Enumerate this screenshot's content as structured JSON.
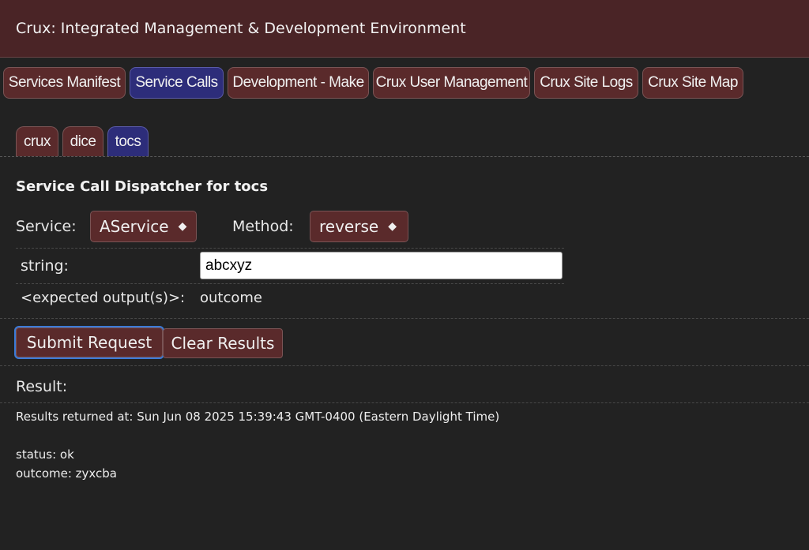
{
  "header": {
    "title": "Crux: Integrated Management & Development Environment"
  },
  "main_tabs": [
    {
      "label": "Services Manifest",
      "active": false
    },
    {
      "label": "Service Calls",
      "active": true
    },
    {
      "label": "Development - Make",
      "active": false
    },
    {
      "label": "Crux User Management",
      "active": false
    },
    {
      "label": "Crux Site Logs",
      "active": false
    },
    {
      "label": "Crux Site Map",
      "active": false
    }
  ],
  "sub_tabs": [
    {
      "label": "crux",
      "active": false
    },
    {
      "label": "dice",
      "active": false
    },
    {
      "label": "tocs",
      "active": true
    }
  ],
  "dispatcher": {
    "heading": "Service Call Dispatcher for tocs",
    "service_label": "Service:",
    "service_value": "AService",
    "method_label": "Method:",
    "method_value": "reverse",
    "dropdown_glyph": "◆",
    "param_label": "string:",
    "param_value": "abcxyz",
    "expected_label": "<expected output(s)>:",
    "expected_value": "outcome"
  },
  "actions": {
    "submit_label": "Submit Request",
    "clear_label": "Clear Results"
  },
  "result": {
    "label": "Result:",
    "timestamp_line": "Results returned at: Sun Jun 08 2025 15:39:43 GMT-0400 (Eastern Daylight Time)",
    "status_line": "status: ok",
    "outcome_line": "outcome: zyxcba"
  },
  "colors": {
    "header_bg": "#4a2426",
    "tab_bg": "#5a2a2b",
    "active_tab_bg": "#2d2d7a",
    "page_bg": "#222222",
    "focus_ring": "#3c7bd8"
  }
}
